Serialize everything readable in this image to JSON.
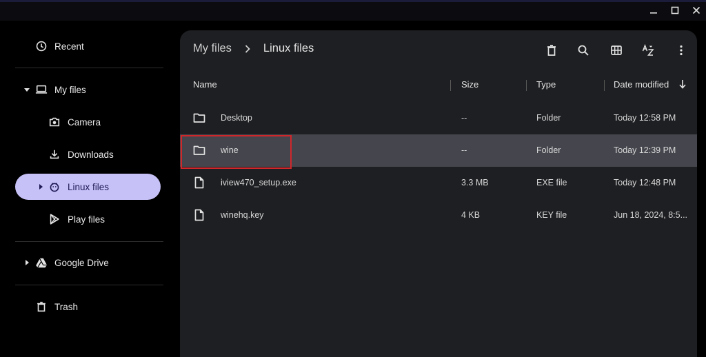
{
  "window": {
    "controls": [
      "minimize-icon",
      "maximize-icon",
      "close-icon"
    ]
  },
  "sidebar": {
    "items": [
      {
        "label": "Recent",
        "icon": "clock-icon"
      },
      {
        "label": "My files",
        "icon": "laptop-icon"
      },
      {
        "label": "Camera",
        "icon": "camera-icon"
      },
      {
        "label": "Downloads",
        "icon": "download-icon"
      },
      {
        "label": "Linux files",
        "icon": "linux-penguin-icon"
      },
      {
        "label": "Play files",
        "icon": "play-store-icon"
      },
      {
        "label": "Google Drive",
        "icon": "google-drive-icon"
      },
      {
        "label": "Trash",
        "icon": "trash-icon"
      }
    ],
    "active": "Linux files"
  },
  "breadcrumb": [
    "My files",
    "Linux files"
  ],
  "toolbar": {
    "buttons": [
      "delete-icon",
      "search-icon",
      "grid-view-icon",
      "sort-az-icon",
      "more-vert-icon"
    ]
  },
  "table": {
    "columns": [
      "Name",
      "Size",
      "Type",
      "Date modified"
    ],
    "sort_column": "Date modified",
    "rows": [
      {
        "name": "Desktop",
        "size": "--",
        "type": "Folder",
        "date": "Today 12:58 PM",
        "kind": "folder"
      },
      {
        "name": "wine",
        "size": "--",
        "type": "Folder",
        "date": "Today 12:39 PM",
        "kind": "folder"
      },
      {
        "name": "iview470_setup.exe",
        "size": "3.3 MB",
        "type": "EXE file",
        "date": "Today 12:48 PM",
        "kind": "file"
      },
      {
        "name": "winehq.key",
        "size": "4 KB",
        "type": "KEY file",
        "date": "Jun 18, 2024, 8:5...",
        "kind": "file"
      }
    ],
    "selected_row": "wine"
  },
  "colors": {
    "active_nav_bg": "#c6c1f7",
    "panel_bg": "#1e1f22",
    "selected_row_bg": "#45464d",
    "annotation_red": "#d0272b"
  }
}
